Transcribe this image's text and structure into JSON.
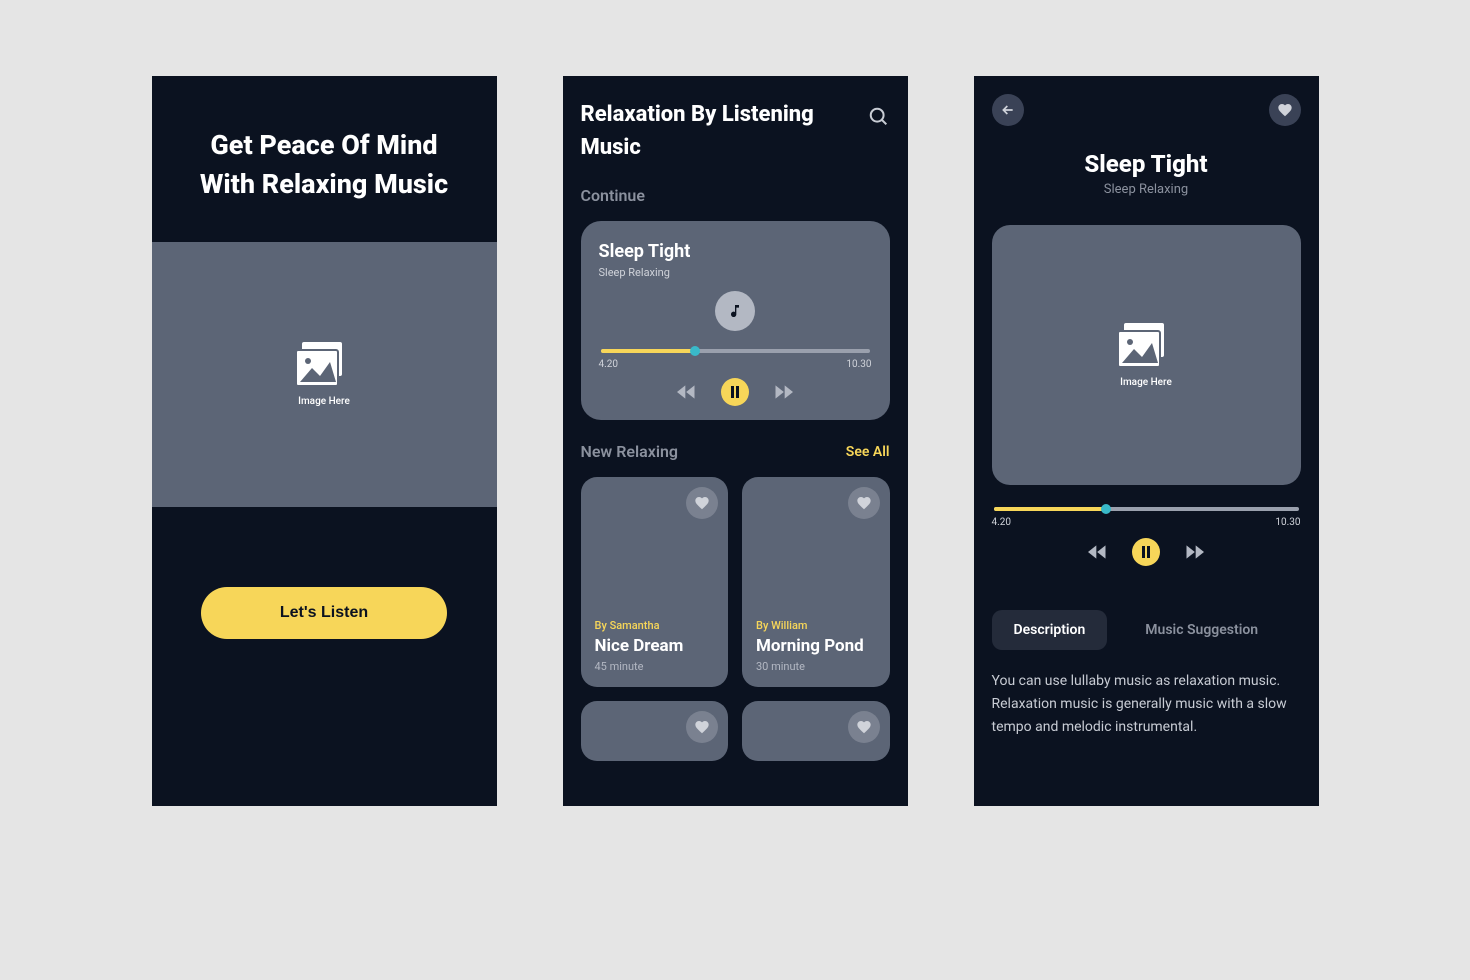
{
  "placeholder_caption": "Image Here",
  "screen1": {
    "title": "Get Peace Of Mind With Relaxing Music",
    "cta": "Let's Listen"
  },
  "screen2": {
    "title": "Relaxation By Listening Music",
    "continue_label": "Continue",
    "player": {
      "title": "Sleep Tight",
      "subtitle": "Sleep Relaxing",
      "current_time": "4.20",
      "total_time": "10.30",
      "progress_pct": 35
    },
    "new_label": "New Relaxing",
    "see_all": "See All",
    "cards": [
      {
        "author": "By Samantha",
        "name": "Nice Dream",
        "duration": "45 minute"
      },
      {
        "author": "By William",
        "name": "Morning Pond",
        "duration": "30 minute"
      }
    ]
  },
  "screen3": {
    "title": "Sleep Tight",
    "subtitle": "Sleep Relaxing",
    "player": {
      "current_time": "4.20",
      "total_time": "10.30",
      "progress_pct": 37
    },
    "tabs": {
      "active": "Description",
      "inactive": "Music Suggestion"
    },
    "description": "You can use lullaby music as relaxation music. Relaxation music is generally music with a slow tempo and melodic instrumental."
  }
}
